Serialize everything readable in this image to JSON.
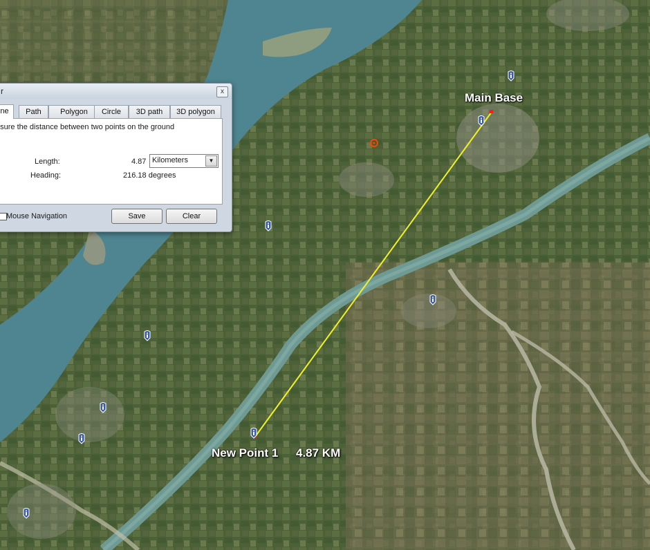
{
  "map": {
    "labels": {
      "main_base": "Main Base",
      "new_point": "New Point 1",
      "distance": "4.87 KM"
    },
    "colors": {
      "measure_line": "#f2f223",
      "river": "#4e8590",
      "canal": "#6f9a94",
      "placemark": "#3b5ba8"
    },
    "icons": [
      "placemark-info-icon",
      "target-icon"
    ]
  },
  "ruler": {
    "title": "r",
    "close_label": "x",
    "tabs": [
      "ne",
      "Path",
      "Polygon",
      "Circle",
      "3D path",
      "3D polygon"
    ],
    "active_tab": "ne",
    "description": "asure the distance between two points on the ground",
    "length_label": "Length:",
    "length_value": "4.87",
    "unit": "Kilometers",
    "heading_label": "Heading:",
    "heading_value": "216.18 degrees",
    "mouse_navigation_label": "Mouse Navigation",
    "save_label": "Save",
    "clear_label": "Clear"
  }
}
